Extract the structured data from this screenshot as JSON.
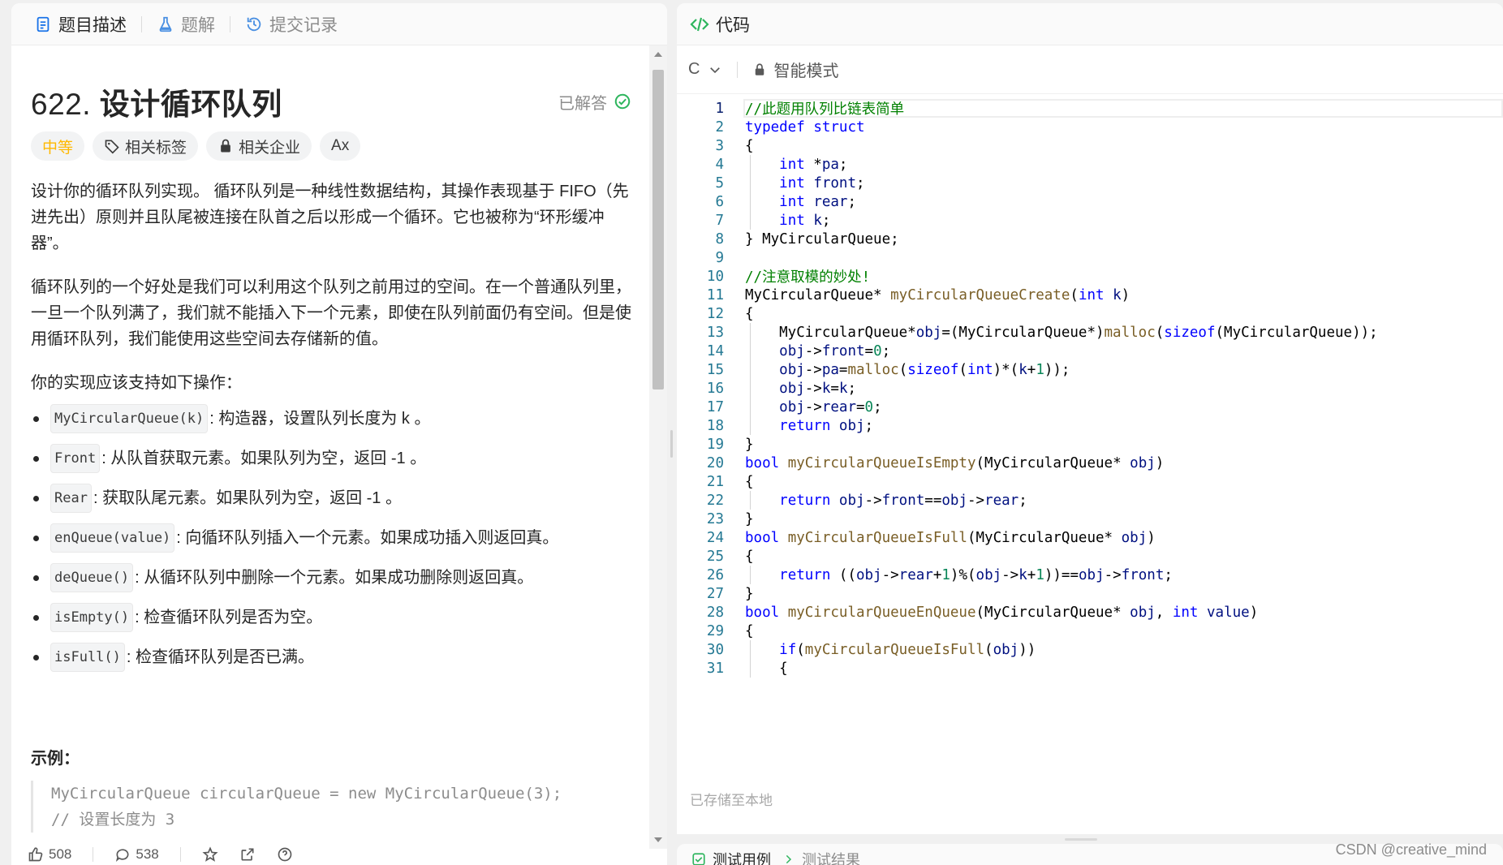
{
  "tabs": [
    {
      "label": "题目描述",
      "icon": "description-icon",
      "active": true
    },
    {
      "label": "题解",
      "icon": "flask-icon",
      "active": false
    },
    {
      "label": "提交记录",
      "icon": "history-icon",
      "active": false
    }
  ],
  "problem": {
    "number": "622.",
    "title": "设计循环队列",
    "status": "已解答",
    "tags": {
      "difficulty": "中等",
      "related_tags": "相关标签",
      "related_companies": "相关企业",
      "translate_icon": "Ax"
    },
    "paragraphs": [
      "设计你的循环队列实现。 循环队列是一种线性数据结构，其操作表现基于 FIFO（先进先出）原则并且队尾被连接在队首之后以形成一个循环。它也被称为“环形缓冲器”。",
      "循环队列的一个好处是我们可以利用这个队列之前用过的空间。在一个普通队列里，一旦一个队列满了，我们就不能插入下一个元素，即使在队列前面仍有空间。但是使用循环队列，我们能使用这些空间去存储新的值。",
      "你的实现应该支持如下操作："
    ],
    "operations": [
      {
        "code": "MyCircularQueue(k)",
        "text": ": 构造器，设置队列长度为 k 。"
      },
      {
        "code": "Front",
        "text": ": 从队首获取元素。如果队列为空，返回 -1 。"
      },
      {
        "code": "Rear",
        "text": ": 获取队尾元素。如果队列为空，返回 -1 。"
      },
      {
        "code": "enQueue(value)",
        "text": ": 向循环队列插入一个元素。如果成功插入则返回真。"
      },
      {
        "code": "deQueue()",
        "text": ": 从循环队列中删除一个元素。如果成功删除则返回真。"
      },
      {
        "code": "isEmpty()",
        "text": ": 检查循环队列是否为空。"
      },
      {
        "code": "isFull()",
        "text": ": 检查循环队列是否已满。"
      }
    ],
    "example_heading": "示例：",
    "example_lines": [
      "MyCircularQueue circularQueue = new MyCircularQueue(3);",
      "// 设置长度为 3"
    ]
  },
  "footer": {
    "likes": "508",
    "comments": "538"
  },
  "code_panel": {
    "title": "代码",
    "language": "C",
    "mode": "智能模式",
    "saved_text": "已存储至本地"
  },
  "code_lines": [
    "//此题用队列比链表简单",
    "typedef struct",
    "{",
    "    int *pa;",
    "    int front;",
    "    int rear;",
    "    int k;",
    "} MyCircularQueue;",
    "",
    "//注意取模的妙处!",
    "MyCircularQueue* myCircularQueueCreate(int k)",
    "{",
    "    MyCircularQueue*obj=(MyCircularQueue*)malloc(sizeof(MyCircularQueue));",
    "    obj->front=0;",
    "    obj->pa=malloc(sizeof(int)*(k+1));",
    "    obj->k=k;",
    "    obj->rear=0;",
    "    return obj;",
    "}",
    "bool myCircularQueueIsEmpty(MyCircularQueue* obj)",
    "{",
    "    return obj->front==obj->rear;",
    "}",
    "bool myCircularQueueIsFull(MyCircularQueue* obj)",
    "{",
    "    return ((obj->rear+1)%(obj->k+1))==obj->front;",
    "}",
    "bool myCircularQueueEnQueue(MyCircularQueue* obj, int value)",
    "{",
    "    if(myCircularQueueIsFull(obj))",
    "    {"
  ],
  "bottom_tabs": {
    "test_case": "测试用例",
    "test_result": "测试结果"
  },
  "watermark": "CSDN @creative_mind",
  "colors": {
    "difficulty": "#ffb800",
    "solved": "#2db55d",
    "keyword": "#0000ff",
    "comment": "#008000",
    "function": "#795e26",
    "number": "#098658",
    "line_number": "#237893"
  }
}
